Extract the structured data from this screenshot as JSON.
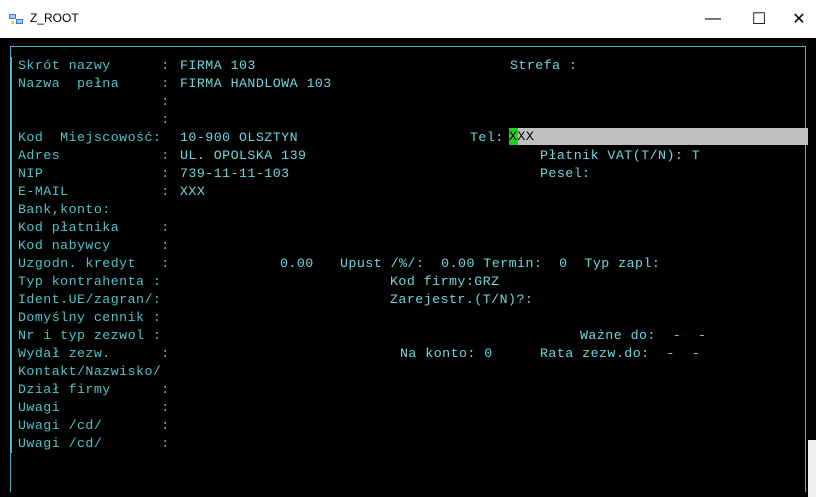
{
  "window": {
    "title": "Z_ROOT",
    "minimize_glyph": "—",
    "maximize_glyph": "☐",
    "close_glyph": "✕"
  },
  "form": {
    "rows": [
      {
        "segs": [
          {
            "t": "Skrót nazwy      :"
          },
          {
            "t": "FIRMA 103"
          },
          {
            "t": "Strefa :"
          }
        ]
      },
      {
        "segs": [
          {
            "t": "Nazwa  pełna     :"
          },
          {
            "t": "FIRMA HANDLOWA 103"
          }
        ]
      },
      {
        "segs": [
          {
            "t": "                 :"
          }
        ]
      },
      {
        "segs": [
          {
            "t": "                 :"
          }
        ]
      },
      {
        "segs": [
          {
            "t": "Kod  Miejscowość:"
          },
          {
            "t": "10-900 OLSZTYN"
          },
          {
            "t": "Tel:"
          }
        ]
      },
      {
        "segs": [
          {
            "t": "Adres            :"
          },
          {
            "t": "UL. OPOLSKA 139"
          },
          {
            "t": "Płatnik VAT(T/N): T"
          }
        ]
      },
      {
        "segs": [
          {
            "t": "NIP              :"
          },
          {
            "t": "739-11-11-103"
          },
          {
            "t": "Pesel:"
          }
        ]
      },
      {
        "segs": [
          {
            "t": "E-MAIL           :"
          },
          {
            "t": "XXX"
          }
        ]
      },
      {
        "segs": [
          {
            "t": "Bank,konto:"
          }
        ]
      },
      {
        "segs": [
          {
            "t": "Kod płatnika     :"
          }
        ]
      },
      {
        "segs": [
          {
            "t": "Kod nabywcy      :"
          }
        ]
      },
      {
        "segs": [
          {
            "t": "Uzgodn. kredyt   :"
          },
          {
            "t": "0.00"
          },
          {
            "t": "Upust /%/:  0.00 Termin:  0  Typ zapl:"
          }
        ]
      },
      {
        "segs": [
          {
            "t": "Typ kontrahenta :"
          },
          {
            "t": "Kod firmy:GRZ"
          }
        ]
      },
      {
        "segs": [
          {
            "t": "Ident.UE/zagran/:"
          },
          {
            "t": "Zarejestr.(T/N)?:"
          }
        ]
      },
      {
        "segs": [
          {
            "t": "Domyślny cennik :"
          }
        ]
      },
      {
        "segs": [
          {
            "t": "Nr i typ zezwol :"
          },
          {
            "t": "Ważne do:  -  -"
          }
        ]
      },
      {
        "segs": [
          {
            "t": "Wydał zezw.      :"
          },
          {
            "t": "Na konto: 0"
          },
          {
            "t": "Rata zezw.do:  -  -"
          }
        ]
      },
      {
        "segs": [
          {
            "t": "Kontakt/Nazwisko/"
          }
        ]
      },
      {
        "segs": [
          {
            "t": "Dział firmy      :"
          }
        ]
      },
      {
        "segs": [
          {
            "t": "Uwagi            :"
          }
        ]
      },
      {
        "segs": [
          {
            "t": "Uwagi /cd/       :"
          }
        ]
      },
      {
        "segs": [
          {
            "t": "Uwagi /cd/       :"
          }
        ]
      }
    ],
    "tel_value": "XXX"
  },
  "colors": {
    "terminal_bg": "#000000",
    "terminal_fg": "#4fc3c9",
    "cursor": "#19d219",
    "field_highlight": "#c0c0c0"
  }
}
